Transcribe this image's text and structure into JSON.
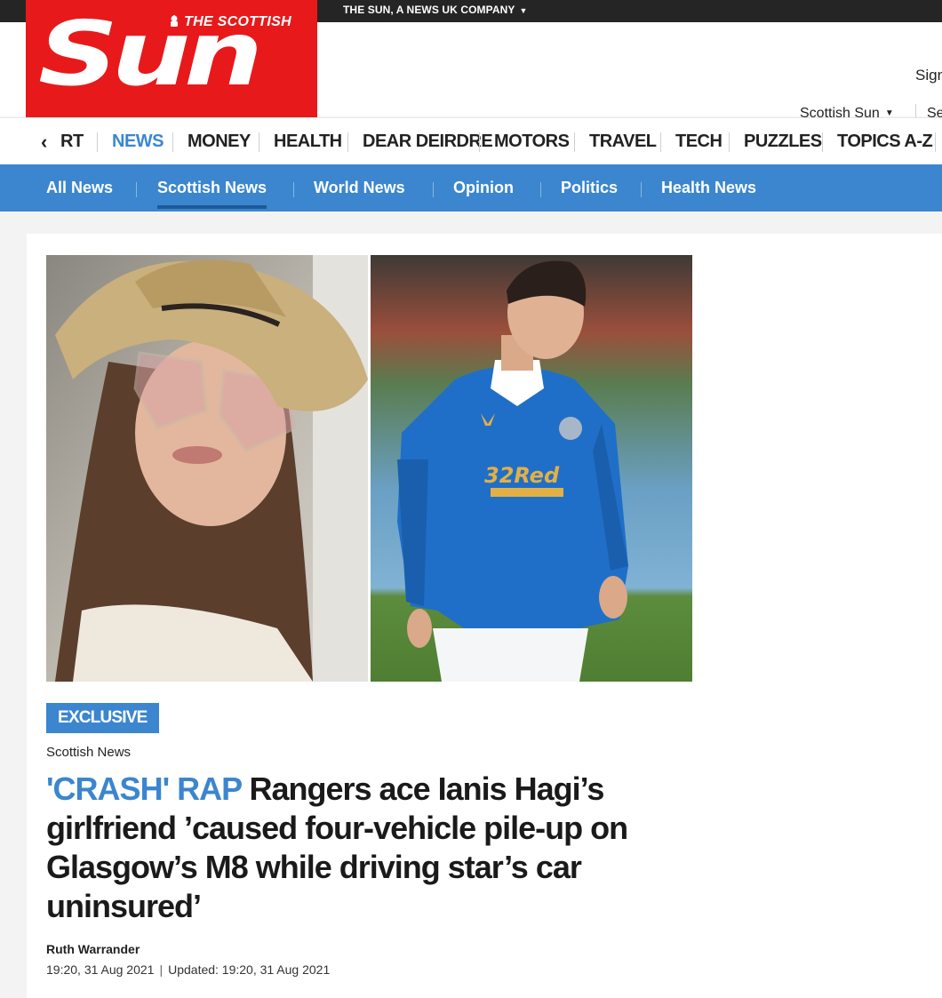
{
  "topbar": {
    "company": "THE SUN, A NEWS UK COMPANY"
  },
  "logo": {
    "tag": "THE SCOTTISH",
    "word": "Sun"
  },
  "header": {
    "sign_in": "Sign",
    "edition": "Scottish Sun",
    "search": "Se"
  },
  "mainnav": {
    "items": [
      "RT",
      "NEWS",
      "MONEY",
      "HEALTH",
      "DEAR DEIRDRE",
      "MOTORS",
      "TRAVEL",
      "TECH",
      "PUZZLES",
      "TOPICS A-Z"
    ],
    "active": "NEWS"
  },
  "subnav": {
    "items": [
      "All News",
      "Scottish News",
      "World News",
      "Opinion",
      "Politics",
      "Health News"
    ],
    "active": "Scottish News"
  },
  "article": {
    "badge": "EXCLUSIVE",
    "kicker": "Scottish News",
    "headline_highlight": "'CRASH' RAP",
    "headline_rest": " Rangers ace Ianis Hagi’s girlfriend ’caused four-vehicle pile-up on Glasgow’s M8 while driving star’s car uninsured’",
    "author": "Ruth Warrander",
    "published": "19:20, 31 Aug 2021",
    "updated": "Updated: 19:20, 31 Aug 2021",
    "shirt_sponsor": "32Red"
  },
  "colors": {
    "brand_red": "#e8191b",
    "accent_blue": "#3b86ce",
    "topbar": "#252525"
  }
}
